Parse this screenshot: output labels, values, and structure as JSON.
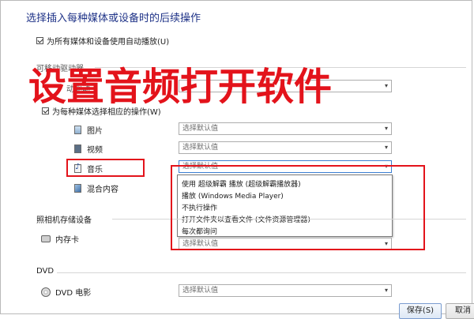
{
  "page": {
    "title": "选择插入每种媒体或设备时的后续操作",
    "autoplay_all_label": "为所有媒体和设备使用自动播放(U)",
    "partial_section_label": "可移动驱动器",
    "partial_row_label": "动驱动",
    "choose_per_media_label": "为每种媒体选择相应的操作(W)"
  },
  "overlay": {
    "title": "设置音频打开软件",
    "color": "#e3131b"
  },
  "media_items": [
    {
      "label": "图片",
      "icon": "picture-icon",
      "select_value": "选择默认值"
    },
    {
      "label": "视频",
      "icon": "video-icon",
      "select_value": "选择默认值"
    },
    {
      "label": "音乐",
      "icon": "music-icon",
      "select_value": "选择默认值"
    },
    {
      "label": "混合内容",
      "icon": "mixed-content-icon"
    }
  ],
  "dropdown": {
    "options": [
      "使用 超级解霸 播放 (超级解霸播放器)",
      "播放 (Windows Media Player)",
      "不执行操作",
      "打开文件夹以查看文件 (文件资源管理器)",
      "每次都询问"
    ]
  },
  "camera_section": {
    "label": "照相机存储设备",
    "device_label": "内存卡",
    "device_icon": "memory-card-icon",
    "select_value": "选择默认值"
  },
  "dvd_section": {
    "label": "DVD",
    "device_label": "DVD 电影",
    "device_icon": "dvd-icon",
    "select_value": "选择默认值"
  },
  "footer": {
    "save_label": "保存(S)",
    "cancel_label": "取消"
  }
}
